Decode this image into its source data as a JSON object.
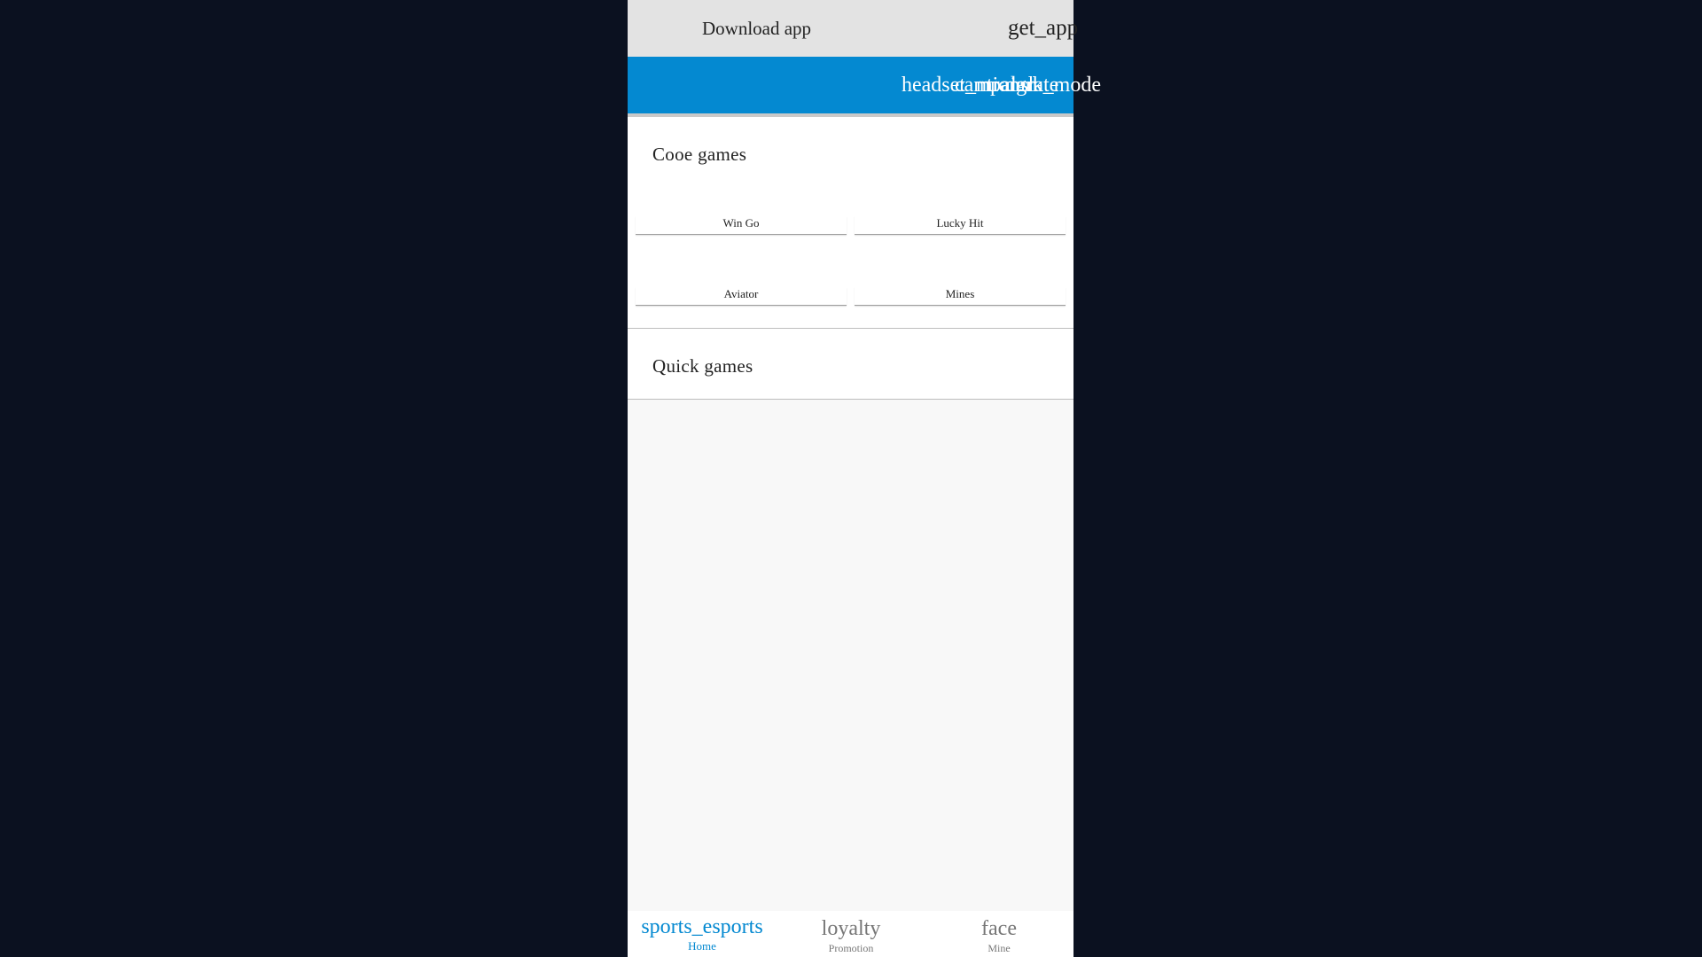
{
  "download_bar": {
    "text": "Download app",
    "icon": "get_app"
  },
  "header": {
    "icons": [
      "headset_mic",
      "campaign",
      "translate",
      "dark_mode"
    ],
    "colors": {
      "background": "#0489d1",
      "icon": "#ffffff"
    }
  },
  "original_games": {
    "title": "Cooe games",
    "games": [
      "Win Go",
      "Lucky Hit",
      "Aviator",
      "Mines"
    ]
  },
  "quick_games": {
    "title": "Quick games"
  },
  "bottom_nav": {
    "items": [
      {
        "icon": "sports_esports",
        "label": "Home",
        "active": true
      },
      {
        "icon": "loyalty",
        "label": "Promotion",
        "active": false
      },
      {
        "icon": "face",
        "label": "Mine",
        "active": false
      }
    ]
  },
  "colors": {
    "accent": "#0489d1",
    "page_background": "#0b1120",
    "app_background": "#f8f8f8"
  }
}
